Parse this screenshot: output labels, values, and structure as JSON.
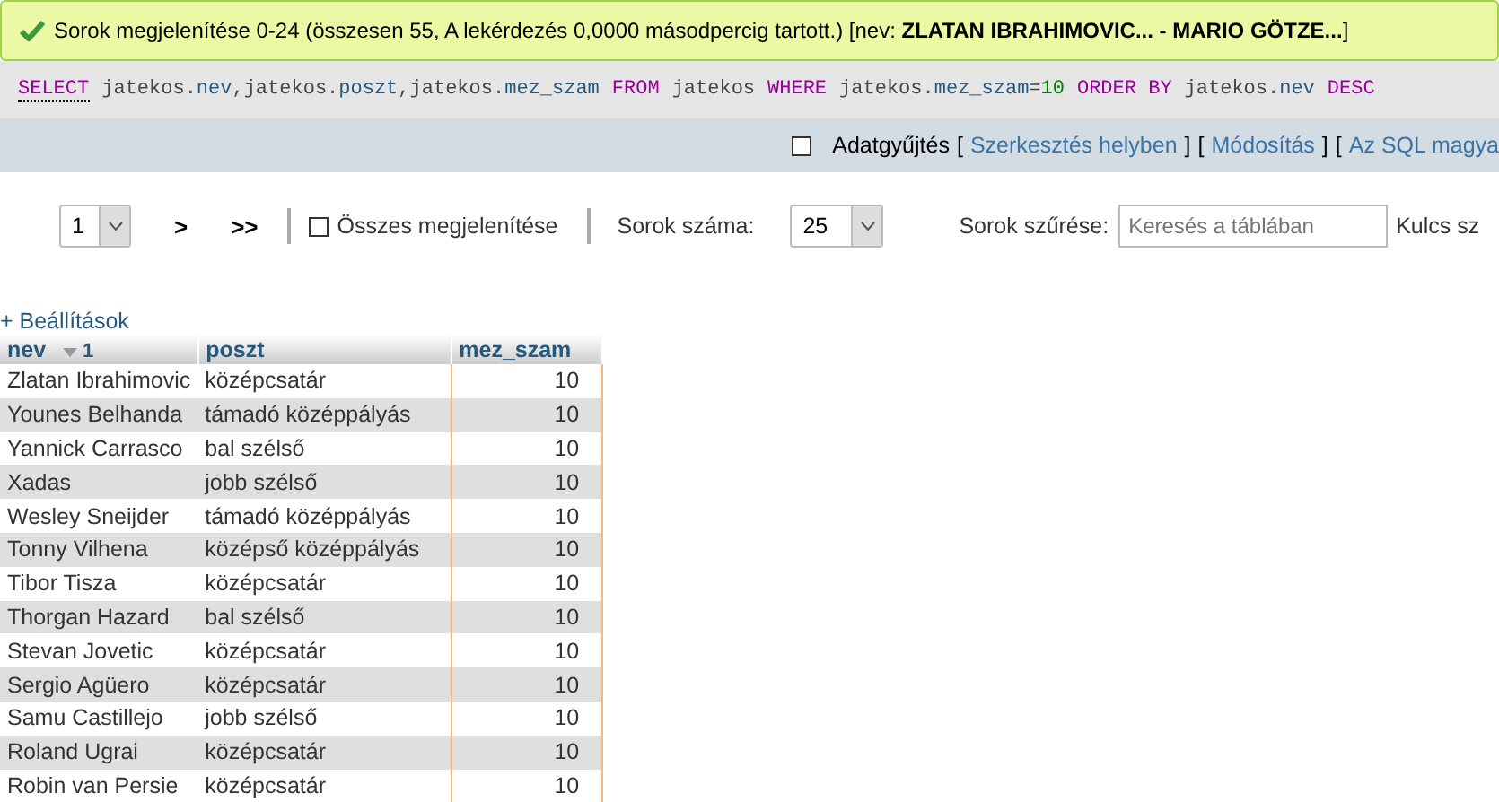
{
  "message": {
    "text": "Sorok megjelenítése 0-24 (összesen 55, A lekérdezés 0,0000 másodpercig tartott.) [nev: **ZLATAN IBRAHIMOVIC... - MARIO GÖTZE...**]"
  },
  "sql": [
    {
      "kind": "keyword",
      "text": "SELECT",
      "underlined": true
    },
    {
      "kind": "plain",
      "text": "jatekos."
    },
    {
      "kind": "field",
      "text": "nev"
    },
    {
      "kind": "plain",
      "text": ",jatekos."
    },
    {
      "kind": "field",
      "text": "poszt"
    },
    {
      "kind": "plain",
      "text": ",jatekos."
    },
    {
      "kind": "field",
      "text": "mez_szam"
    },
    {
      "kind": "keyword",
      "text": "FROM",
      "underlined": false
    },
    {
      "kind": "plain",
      "text": "jatekos"
    },
    {
      "kind": "keyword",
      "text": "WHERE",
      "underlined": false
    },
    {
      "kind": "plain",
      "text": "jatekos."
    },
    {
      "kind": "field",
      "text": "mez_szam"
    },
    {
      "kind": "plain",
      "text": "="
    },
    {
      "kind": "number",
      "text": "10"
    },
    {
      "kind": "keyword",
      "text": "ORDER BY",
      "underlined": false
    },
    {
      "kind": "plain",
      "text": "jatekos."
    },
    {
      "kind": "field",
      "text": "nev"
    },
    {
      "kind": "keyword",
      "text": "DESC",
      "underlined": false
    }
  ],
  "actions": {
    "profiling": {
      "label": "Adatgyűjtés",
      "checked": false
    },
    "items": [
      {
        "kind": "bracket",
        "text": "["
      },
      {
        "kind": "link",
        "text": "Szerkesztés helyben"
      },
      {
        "kind": "bracket",
        "text": "]"
      },
      {
        "kind": "bracket",
        "text": "["
      },
      {
        "kind": "link",
        "text": "Módosítás"
      },
      {
        "kind": "bracket",
        "text": "]"
      },
      {
        "kind": "bracket",
        "text": "["
      },
      {
        "kind": "link",
        "text": "Az SQL magya"
      }
    ]
  },
  "navigation": {
    "page": "1",
    "next": ">",
    "last": ">>",
    "show_all": {
      "label": "Összes megjelenítése",
      "checked": false
    },
    "rows_label": "Sorok száma:",
    "rows_value": "25",
    "filter_label": "Sorok szűrése:",
    "filter_placeholder": "Keresés a táblában",
    "key_label": "Kulcs sz"
  },
  "settings_link": "+ Beállítások",
  "table": {
    "columns": [
      {
        "name": "nev",
        "sort_icon": true,
        "sort_order": "1"
      },
      {
        "name": "poszt",
        "sort_icon": false
      },
      {
        "name": "mez_szam",
        "sort_icon": false
      }
    ],
    "rows": [
      [
        "Zlatan Ibrahimovic",
        "középcsatár",
        "10"
      ],
      [
        "Younes Belhanda",
        "támadó középpályás",
        "10"
      ],
      [
        "Yannick Carrasco",
        "bal szélső",
        "10"
      ],
      [
        "Xadas",
        "jobb szélső",
        "10"
      ],
      [
        "Wesley Sneijder",
        "támadó középpályás",
        "10"
      ],
      [
        "Tonny Vilhena",
        "középső középpályás",
        "10"
      ],
      [
        "Tibor Tisza",
        "középcsatár",
        "10"
      ],
      [
        "Thorgan Hazard",
        "bal szélső",
        "10"
      ],
      [
        "Stevan Jovetic",
        "középcsatár",
        "10"
      ],
      [
        "Sergio Agüero",
        "középcsatár",
        "10"
      ],
      [
        "Samu Castillejo",
        "jobb szélső",
        "10"
      ],
      [
        "Roland Ugrai",
        "középcsatár",
        "10"
      ],
      [
        "Robin van Persie",
        "középcsatár",
        "10"
      ]
    ]
  }
}
